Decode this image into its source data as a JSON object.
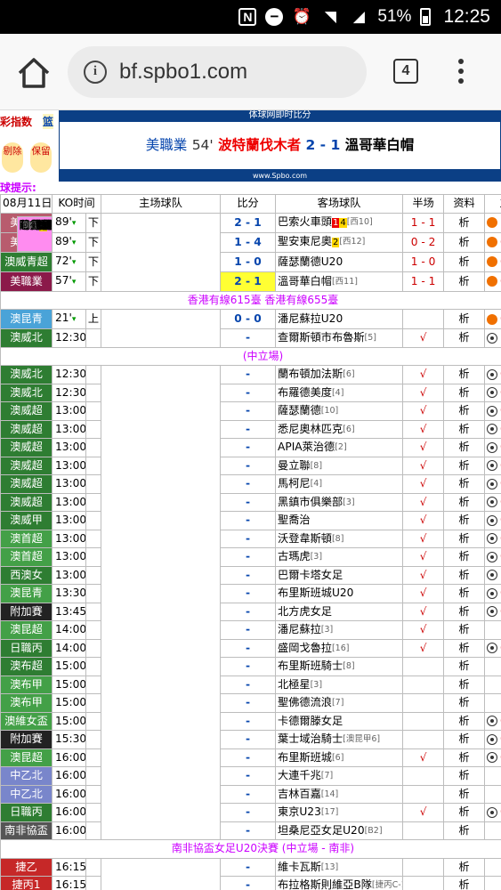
{
  "status_bar": {
    "nfc": "N",
    "time": "12:25",
    "battery": "51%"
  },
  "browser": {
    "url": "bf.spbo1.com",
    "tab_count": "4"
  },
  "toolbar": {
    "odds_link": "彩指数",
    "basketball_link": "篮"
  },
  "banner": {
    "top": "体球网即时比分",
    "league": "美職業",
    "minute": "54'",
    "home": "波特蘭伐木者",
    "score": "2 - 1",
    "away": "溫哥華白帽",
    "footer": "www.Spbo.com"
  },
  "side": {
    "btn1": "剔除",
    "btn2": "保留"
  },
  "tip": "球提示:",
  "headers": {
    "date": "08月11日",
    "ko": "KO时间",
    "home": "主场球队",
    "score": "比分",
    "away": "客场球队",
    "half": "半场",
    "info": "资料",
    "extra": "主"
  },
  "rows": [
    {
      "type": "match",
      "league": "美冠聯",
      "color": "#b85c6e",
      "ko": "89'",
      "live": true,
      "st": "下",
      "home_rank": "[西1]",
      "home_cards": [
        {
          "c": "y",
          "n": "1"
        }
      ],
      "home": "鳳凰重生",
      "score": "2 - 1",
      "away": "巴索火車頭",
      "away_cards": [
        {
          "c": "r",
          "n": "1"
        },
        {
          "c": "y",
          "n": "4"
        }
      ],
      "away_rank": "[西10]",
      "half": "1 - 1",
      "info": "析",
      "icon": "ball",
      "extra": "1"
    },
    {
      "type": "match",
      "league": "美冠聯",
      "color": "#b85c6e",
      "ko": "89'",
      "live": true,
      "st": "下",
      "home_rank": "[西2]",
      "home_cards": [
        {
          "c": "y",
          "n": "4"
        },
        {
          "c": "r",
          "n": "1"
        }
      ],
      "home": "雷諾1868",
      "score": "1 - 4",
      "away": "聖安東尼奧",
      "away_cards": [
        {
          "c": "y",
          "n": "2"
        }
      ],
      "away_rank": "[西12]",
      "half": "0 - 2",
      "info": "析",
      "icon": "ball",
      "extra": "0."
    },
    {
      "type": "match",
      "league": "澳威青超",
      "color": "#2e7d32",
      "ko": "72'",
      "live": true,
      "st": "下",
      "home_rank": "",
      "home_cards": [],
      "home": "洛克達爾U20",
      "score": "1 - 0",
      "away": "薩瑟蘭德U20",
      "away_cards": [],
      "away_rank": "",
      "half": "1 - 0",
      "info": "析",
      "icon": "ball",
      "extra": "0."
    },
    {
      "type": "match",
      "league": "美職業",
      "color": "#8b1a4a",
      "ko": "57'",
      "live": true,
      "st": "下",
      "home_rank": "[西8]",
      "home_cards": [
        {
          "c": "y",
          "n": "1"
        }
      ],
      "home": "波特蘭伐木者",
      "score": "2 - 1",
      "away": "溫哥華白帽",
      "away_cards": [],
      "away_rank": "[西11]",
      "half": "1 - 1",
      "info": "析",
      "icon": "ball",
      "extra": "0.",
      "highlight": true
    },
    {
      "type": "note",
      "text": "香港有線615臺 香港有線655臺"
    },
    {
      "type": "match",
      "league": "澳昆青",
      "color": "#4aa3d8",
      "ko": "21'",
      "live": true,
      "st": "上",
      "home_rank": "",
      "home_cards": [],
      "home": "陽光海岸U20",
      "score": "0 - 0",
      "away": "潘尼蘇拉U20",
      "away_cards": [],
      "away_rank": "",
      "half": "",
      "info": "析",
      "icon": "ball",
      "extra": "0"
    },
    {
      "type": "match",
      "league": "澳威北",
      "color": "#2e7d32",
      "ko": "12:30",
      "live": false,
      "st": "",
      "home_rank": "[7]",
      "home_cards": [],
      "home": "紐卡斯托U21",
      "score": "-",
      "away": "查爾斯頓市布魯斯",
      "away_cards": [],
      "away_rank": "[5]",
      "half": "√",
      "info": "析",
      "icon": "sball",
      "extra": "1."
    },
    {
      "type": "note",
      "text": "(中立場)"
    },
    {
      "type": "match",
      "league": "澳威北",
      "color": "#2e7d32",
      "ko": "12:30",
      "live": false,
      "st": "",
      "home_rank": "[10]",
      "home_cards": [],
      "home": "麥覺理湖城",
      "score": "-",
      "away": "蘭布頓加法斯",
      "away_cards": [],
      "away_rank": "[6]",
      "half": "√",
      "info": "析",
      "icon": "sball",
      "extra": "0."
    },
    {
      "type": "match",
      "league": "澳威北",
      "color": "#2e7d32",
      "ko": "12:30",
      "live": false,
      "st": "",
      "home_rank": "[8]",
      "home_cards": [],
      "home": "咸美頓奧林匹克",
      "score": "-",
      "away": "布羅德美度",
      "away_cards": [],
      "away_rank": "[4]",
      "half": "√",
      "info": "析",
      "icon": "sball",
      "extra": "0."
    },
    {
      "type": "match",
      "league": "澳威超",
      "color": "#2e7d32",
      "ko": "13:00",
      "live": false,
      "st": "",
      "home_rank": "[9]",
      "home_cards": [],
      "home": "洛克達爾",
      "score": "-",
      "away": "薩瑟蘭德",
      "away_cards": [],
      "away_rank": "[10]",
      "half": "√",
      "info": "析",
      "icon": "sball",
      "extra": "0."
    },
    {
      "type": "match",
      "league": "澳威超",
      "color": "#2e7d32",
      "ko": "13:00",
      "live": false,
      "st": "",
      "home_rank": "[11]",
      "home_cards": [],
      "home": "悉尼U21",
      "score": "-",
      "away": "悉尼奧林匹克",
      "away_cards": [],
      "away_rank": "[6]",
      "half": "√",
      "info": "析",
      "icon": "sball",
      "extra": "0."
    },
    {
      "type": "match",
      "league": "澳威超",
      "color": "#2e7d32",
      "ko": "13:00",
      "live": false,
      "st": "",
      "home_rank": "[7]",
      "home_cards": [],
      "home": "芒特德瑞特城流浪者",
      "score": "-",
      "away": "APIA萊治德",
      "away_cards": [],
      "away_rank": "[2]",
      "half": "√",
      "info": "析",
      "icon": "sball",
      "extra": "0."
    },
    {
      "type": "match",
      "league": "澳威超",
      "color": "#2e7d32",
      "ko": "13:00",
      "live": false,
      "st": "",
      "home_rank": "[5]",
      "home_cards": [],
      "home": "悉尼聯盟",
      "score": "-",
      "away": "曼立聯",
      "away_cards": [],
      "away_rank": "[8]",
      "half": "√",
      "info": "析",
      "icon": "sball",
      "extra": "0."
    },
    {
      "type": "match",
      "league": "澳威超",
      "color": "#2e7d32",
      "ko": "13:00",
      "live": false,
      "st": "",
      "home_rank": "[1]",
      "home_cards": [],
      "home": "臥龍崗狼隊",
      "score": "-",
      "away": "馬柯尼",
      "away_cards": [],
      "away_rank": "[4]",
      "half": "√",
      "info": "析",
      "icon": "sball",
      "extra": "0."
    },
    {
      "type": "match",
      "league": "澳威超",
      "color": "#2e7d32",
      "ko": "13:00",
      "live": false,
      "st": "",
      "home_rank": "[12]",
      "home_cards": [],
      "home": "哈柯亞東悉尼市",
      "score": "-",
      "away": "黑鎮市俱樂部",
      "away_cards": [],
      "away_rank": "[3]",
      "half": "√",
      "info": "析",
      "icon": "sball",
      "extra": "0."
    },
    {
      "type": "match",
      "league": "澳威甲",
      "color": "#2e7d32",
      "ko": "13:00",
      "live": false,
      "st": "",
      "home_rank": "",
      "home_cards": [],
      "home": "莱德米爾獅子",
      "score": "-",
      "away": "聖喬治",
      "away_cards": [],
      "away_rank": "",
      "half": "√",
      "info": "析",
      "icon": "sball",
      "extra": "0."
    },
    {
      "type": "match",
      "league": "澳首超",
      "color": "#43a047",
      "ko": "13:00",
      "live": false,
      "st": "",
      "home_rank": "[7]",
      "home_cards": [],
      "home": "塔格拉諾",
      "score": "-",
      "away": "沃登韋斯頓",
      "away_cards": [],
      "away_rank": "[8]",
      "half": "√",
      "info": "析",
      "icon": "sball",
      "extra": "0."
    },
    {
      "type": "match",
      "league": "澳首超",
      "color": "#43a047",
      "ko": "13:00",
      "live": false,
      "st": "",
      "home_rank": "[1]",
      "home_cards": [],
      "home": "甘加林聯",
      "score": "-",
      "away": "古瑪虎",
      "away_cards": [],
      "away_rank": "[3]",
      "half": "√",
      "info": "析",
      "icon": "sball",
      "extra": "0."
    },
    {
      "type": "match",
      "league": "西澳女",
      "color": "#2e7d32",
      "ko": "13:00",
      "live": false,
      "st": "",
      "home_rank": "",
      "home_cards": [],
      "home": "北部瑞德巴克女足",
      "score": "-",
      "away": "巴爾卡塔女足",
      "away_cards": [],
      "away_rank": "",
      "half": "√",
      "info": "析",
      "icon": "sball",
      "extra": "1."
    },
    {
      "type": "match",
      "league": "澳昆青",
      "color": "#43a047",
      "ko": "13:30",
      "live": false,
      "st": "",
      "home_rank": "",
      "home_cards": [],
      "home": "布里斯班奧林匹克U20",
      "score": "-",
      "away": "布里斯班城U20",
      "away_cards": [],
      "away_rank": "",
      "half": "√",
      "info": "析",
      "icon": "sball",
      "extra": "0."
    },
    {
      "type": "match",
      "league": "附加賽",
      "color": "#222",
      "ko": "13:45",
      "live": false,
      "st": "",
      "home_rank": "",
      "home_cards": [],
      "home": "悉尼奧林匹克女足",
      "score": "-",
      "away": "北方虎女足",
      "away_cards": [],
      "away_rank": "",
      "half": "√",
      "info": "析",
      "icon": "sball",
      "extra": "0."
    },
    {
      "type": "match",
      "league": "澳昆超",
      "color": "#43a047",
      "ko": "14:00",
      "live": false,
      "st": "",
      "home_rank": "[15]",
      "home_cards": [],
      "home": "陽光海岸",
      "score": "-",
      "away": "潘尼蘇拉",
      "away_cards": [],
      "away_rank": "[3]",
      "half": "√",
      "info": "析",
      "icon": "",
      "extra": ""
    },
    {
      "type": "match",
      "league": "日職丙",
      "color": "#2e7d32",
      "ko": "14:00",
      "live": false,
      "st": "",
      "home_rank": "[14]",
      "home_cards": [],
      "home": "淺藍沼津",
      "score": "-",
      "away": "盛岡戈魯拉",
      "away_cards": [],
      "away_rank": "[16]",
      "half": "√",
      "info": "析",
      "icon": "sball",
      "extra": "0."
    },
    {
      "type": "match",
      "league": "澳布超",
      "color": "#2e7d32",
      "ko": "15:00",
      "live": false,
      "st": "",
      "home_rank": "[1]",
      "home_cards": [],
      "home": "阿爾巴尼克里克",
      "score": "-",
      "away": "布里斯班騎士",
      "away_cards": [],
      "away_rank": "[8]",
      "half": "",
      "info": "析",
      "icon": "",
      "extra": ""
    },
    {
      "type": "match",
      "league": "澳布甲",
      "color": "#43a047",
      "ko": "15:00",
      "live": false,
      "st": "",
      "home_rank": "[8]",
      "home_cards": [],
      "home": "格拉瓦特山",
      "score": "-",
      "away": "北極星",
      "away_cards": [],
      "away_rank": "[3]",
      "half": "",
      "info": "析",
      "icon": "",
      "extra": ""
    },
    {
      "type": "match",
      "league": "澳布甲",
      "color": "#43a047",
      "ko": "15:00",
      "live": false,
      "st": "",
      "home_rank": "[1]",
      "home_cards": [],
      "home": "聖喬治維拉爵",
      "score": "-",
      "away": "聖佛德流浪",
      "away_cards": [],
      "away_rank": "[7]",
      "half": "",
      "info": "析",
      "icon": "",
      "extra": ""
    },
    {
      "type": "match",
      "league": "澳維女盃",
      "color": "#43a047",
      "ko": "15:00",
      "live": false,
      "st": "",
      "home_rank": "",
      "home_cards": [],
      "home": "波克海爾女足",
      "score": "-",
      "away": "卡德爾滕女足",
      "away_cards": [],
      "away_rank": "",
      "half": "",
      "info": "析",
      "icon": "sball",
      "extra": "0."
    },
    {
      "type": "match",
      "league": "附加賽",
      "color": "#222",
      "ko": "15:30",
      "live": false,
      "st": "",
      "home_rank": "[澳昆甲3]",
      "home_cards": [],
      "home": "洛根利泰梓",
      "score": "-",
      "away": "葉士域治騎士",
      "away_cards": [],
      "away_rank": "[澳昆甲6]",
      "half": "",
      "info": "析",
      "icon": "sball",
      "extra": "0."
    },
    {
      "type": "match",
      "league": "澳昆超",
      "color": "#43a047",
      "ko": "16:00",
      "live": false,
      "st": "",
      "home_rank": "[4]",
      "home_cards": [],
      "home": "布里斯班奧林匹克",
      "score": "-",
      "away": "布里斯班城",
      "away_cards": [],
      "away_rank": "[6]",
      "half": "√",
      "info": "析",
      "icon": "sball",
      "extra": "0."
    },
    {
      "type": "match",
      "league": "中乙北",
      "color": "#7986cb",
      "ko": "16:00",
      "live": false,
      "st": "",
      "home_rank": "[13]",
      "home_cards": [],
      "home": "西安大興崇德",
      "score": "-",
      "away": "大連千兆",
      "away_cards": [],
      "away_rank": "[7]",
      "half": "",
      "info": "析",
      "icon": "",
      "extra": ""
    },
    {
      "type": "match",
      "league": "中乙北",
      "color": "#7986cb",
      "ko": "16:00",
      "live": false,
      "st": "",
      "home_rank": "[16]",
      "home_cards": [],
      "home": "山西信都",
      "score": "-",
      "away": "吉林百嘉",
      "away_cards": [],
      "away_rank": "[14]",
      "half": "",
      "info": "析",
      "icon": "",
      "extra": ""
    },
    {
      "type": "match",
      "league": "日職丙",
      "color": "#2e7d32",
      "ko": "16:00",
      "live": false,
      "st": "",
      "home_rank": "[15]",
      "home_cards": [],
      "home": "長野",
      "score": "-",
      "away": "東京U23",
      "away_cards": [],
      "away_rank": "[17]",
      "half": "√",
      "info": "析",
      "icon": "sball",
      "extra": "0."
    },
    {
      "type": "match",
      "league": "南非協盃",
      "color": "#555",
      "ko": "16:00",
      "live": false,
      "st": "",
      "home_rank": "[B1]",
      "home_cards": [],
      "home": "贊比亞女足U20",
      "score": "-",
      "away": "坦桑尼亞女足U20",
      "away_cards": [],
      "away_rank": "[B2]",
      "half": "",
      "info": "析",
      "icon": "",
      "extra": ""
    },
    {
      "type": "note",
      "text": "南非協盃女足U20決賽 (中立場 - 南非)"
    },
    {
      "type": "match",
      "league": "捷乙",
      "color": "#c62828",
      "ko": "16:15",
      "live": false,
      "st": "",
      "home_rank": "[14]",
      "home_cards": [],
      "home": "薛斯高夫",
      "score": "-",
      "away": "維卡瓦斯",
      "away_cards": [],
      "away_rank": "[13]",
      "half": "",
      "info": "析",
      "icon": "",
      "extra": ""
    },
    {
      "type": "match",
      "league": "捷丙1",
      "color": "#c62828",
      "ko": "16:15",
      "live": false,
      "st": "",
      "home_rank": "",
      "home_cards": [],
      "home": "阿德米拉布拉格",
      "score": "-",
      "away": "布拉格斯則維亞B隊",
      "away_cards": [],
      "away_rank": "[捷丙C-17]",
      "half": "",
      "info": "析",
      "icon": "",
      "extra": ""
    }
  ]
}
